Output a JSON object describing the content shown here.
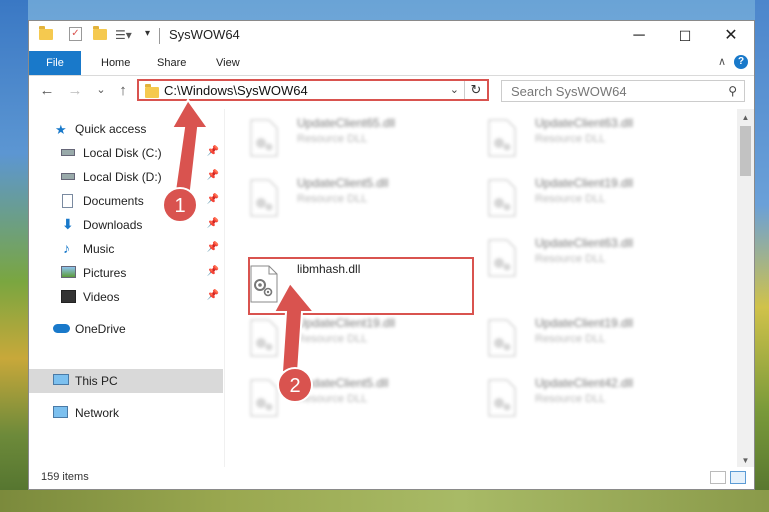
{
  "window": {
    "title": "SysWOW64",
    "minimize_label": "─",
    "maximize_label": "☐",
    "close_label": "✕"
  },
  "ribbon": {
    "tabs": [
      "File",
      "Home",
      "Share",
      "View"
    ],
    "help": "?",
    "collapse": "∧"
  },
  "nav": {
    "back": "←",
    "forward": "→",
    "recent": "⌄",
    "up": "↑"
  },
  "address": {
    "path": "C:\\Windows\\SysWOW64",
    "dropdown": "⌄",
    "refresh": "↻"
  },
  "search": {
    "placeholder": "Search SysWOW64",
    "icon": "⚲"
  },
  "sidebar": {
    "items": [
      {
        "label": "Quick access",
        "icon": "star-icon",
        "pinned": false
      },
      {
        "label": "Local Disk (C:)",
        "icon": "drive-icon",
        "pinned": true
      },
      {
        "label": "Local Disk (D:)",
        "icon": "drive-icon",
        "pinned": true
      },
      {
        "label": "Documents",
        "icon": "document-icon",
        "pinned": true
      },
      {
        "label": "Downloads",
        "icon": "download-icon",
        "pinned": true
      },
      {
        "label": "Music",
        "icon": "music-icon",
        "pinned": true
      },
      {
        "label": "Pictures",
        "icon": "pictures-icon",
        "pinned": true
      },
      {
        "label": "Videos",
        "icon": "videos-icon",
        "pinned": true
      },
      {
        "label": "OneDrive",
        "icon": "cloud-icon",
        "pinned": false
      },
      {
        "label": "This PC",
        "icon": "computer-icon",
        "pinned": false
      },
      {
        "label": "Network",
        "icon": "network-icon",
        "pinned": false
      }
    ],
    "pin_glyph": "📌",
    "selected": "This PC"
  },
  "files": [
    {
      "name": "UpdateClient65.dll",
      "type": "Resource DLL",
      "blurred": true
    },
    {
      "name": "UpdateClient63.dll",
      "type": "Resource DLL",
      "blurred": true
    },
    {
      "name": "UpdateClient5.dll",
      "type": "Resource DLL",
      "blurred": true
    },
    {
      "name": "UpdateClient19.dll",
      "type": "Resource DLL",
      "blurred": true
    },
    {
      "name": "libmhash.dll",
      "type": "",
      "blurred": false
    },
    {
      "name": "UpdateClient63.dll",
      "type": "Resource DLL",
      "blurred": true
    },
    {
      "name": "UpdateClient19.dll",
      "type": "Resource DLL",
      "blurred": true
    },
    {
      "name": "UpdateClient19.dll",
      "type": "Resource DLL",
      "blurred": true
    },
    {
      "name": "UpdateClient5.dll",
      "type": "Resource DLL",
      "blurred": true
    },
    {
      "name": "UpdateClient42.dll",
      "type": "Resource DLL",
      "blurred": true
    }
  ],
  "status": {
    "item_count": "159 items"
  },
  "annotations": {
    "step1": "1",
    "step2": "2",
    "color": "#d9534f"
  }
}
